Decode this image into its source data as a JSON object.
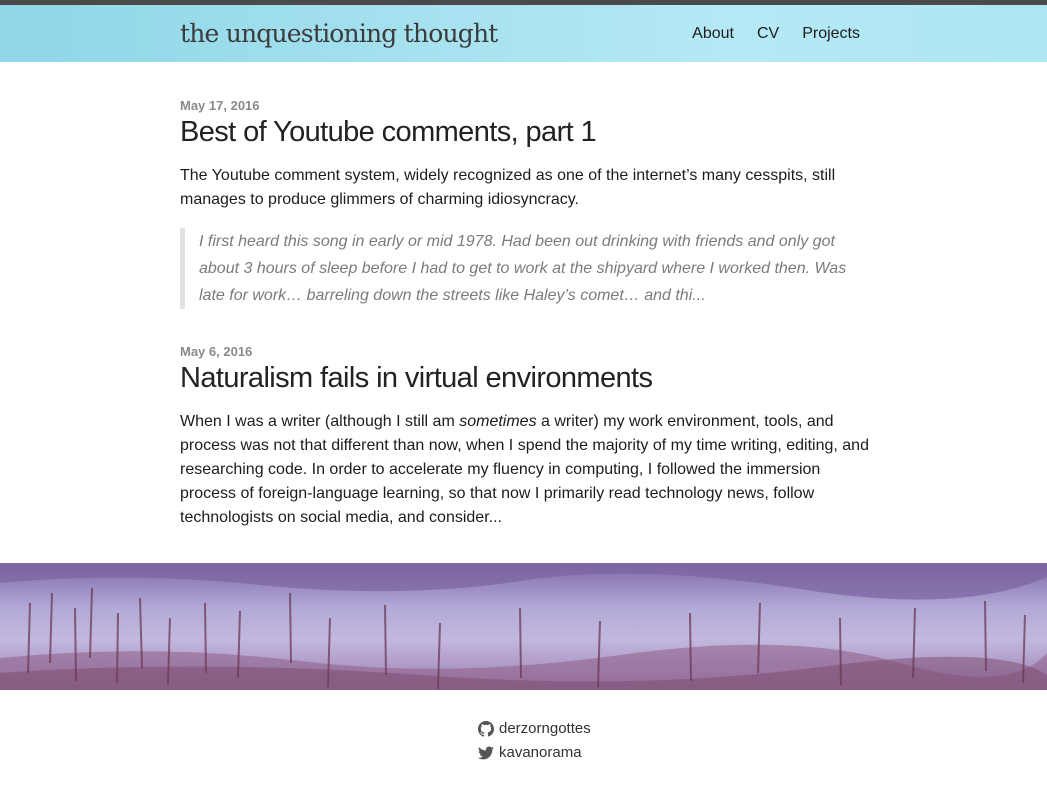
{
  "site": {
    "title": "the unquestioning thought"
  },
  "nav": [
    {
      "label": "About"
    },
    {
      "label": "CV"
    },
    {
      "label": "Projects"
    }
  ],
  "posts": [
    {
      "date": "May 17, 2016",
      "title": "Best of Youtube comments, part 1",
      "excerpt": "The Youtube comment system, widely recognized as one of the internet’s many cesspits, still manages to produce glimmers of charming idiosyncracy.",
      "quote": "I first heard this song in early or mid 1978. Had been out drinking with friends and only got about 3 hours of sleep before I had to get to work at the shipyard where I worked then. Was late for work… barreling down the streets like Haley’s comet… and thi..."
    },
    {
      "date": "May 6, 2016",
      "title": "Naturalism fails in virtual environments",
      "excerpt_before": "When I was a writer (although I still am ",
      "excerpt_em": "sometimes",
      "excerpt_after": " a writer) my work environment, tools, and process was not that different than now, when I spend the majority of my time writing, editing, and researching code. In order to accelerate my fluency in computing, I followed the immersion process of foreign-language learning, so that now I primarily read technology news, follow technologists on social media, and consider..."
    }
  ],
  "footer": {
    "github": {
      "icon": "github-icon",
      "handle": "derzorngottes"
    },
    "twitter": {
      "icon": "twitter-icon",
      "handle": "kavanorama"
    }
  },
  "colors": {
    "header": "#a6e1ef",
    "topbar": "#4a4a4a",
    "banner": "#a196c8"
  }
}
